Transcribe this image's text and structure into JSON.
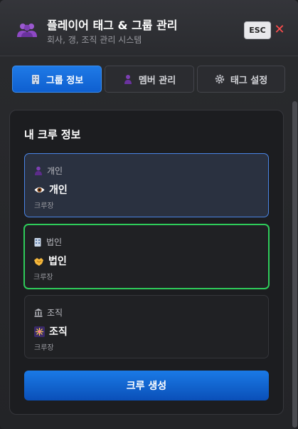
{
  "header": {
    "title": "플레이어 태그 & 그룹 관리",
    "subtitle": "회사, 갱, 조직 관리 시스템",
    "icon": "people-group-icon",
    "esc_label": "ESC",
    "close_label": "✕"
  },
  "tabs": [
    {
      "label": "그룹 정보",
      "icon": "building-icon",
      "active": true
    },
    {
      "label": "멤버 관리",
      "icon": "person-icon",
      "active": false
    },
    {
      "label": "태그 설정",
      "icon": "gear-icon",
      "active": false
    }
  ],
  "section": {
    "title": "내 크루 정보"
  },
  "crews": [
    {
      "category": "개인",
      "category_icon": "person-icon",
      "name": "개인",
      "name_icon": "eye-icon",
      "role": "크루장",
      "state": "hover",
      "accent": "#4a85e6"
    },
    {
      "category": "법인",
      "category_icon": "building-icon",
      "name": "법인",
      "name_icon": "handshake-icon",
      "role": "크루장",
      "state": "selected",
      "accent": "#2ecc5a"
    },
    {
      "category": "조직",
      "category_icon": "bank-icon",
      "name": "조직",
      "name_icon": "firework-icon",
      "role": "크루장",
      "state": "default"
    }
  ],
  "create_button": {
    "label": "크루 생성"
  },
  "colors": {
    "primary": "#1a7ae6",
    "selected": "#2ecc5a",
    "close": "#ff4d4d"
  }
}
